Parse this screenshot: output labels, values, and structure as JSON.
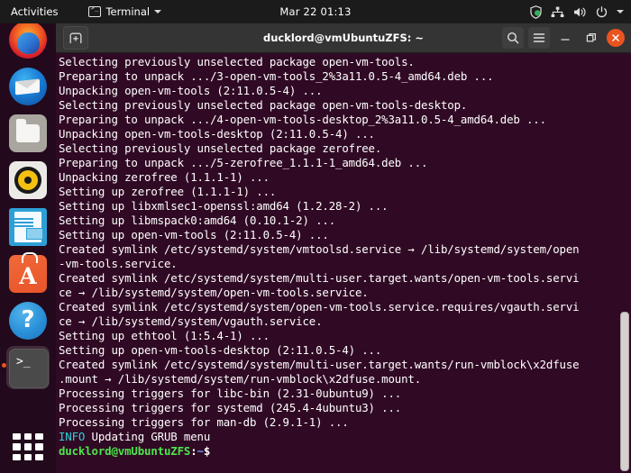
{
  "topbar": {
    "activities": "Activities",
    "app_menu": "Terminal",
    "clock": "Mar 22  01:13",
    "icons": [
      "shield-icon",
      "network-icon",
      "volume-icon",
      "power-icon",
      "chevron-down-icon"
    ]
  },
  "dock": {
    "items": [
      {
        "name": "firefox",
        "label": "Firefox",
        "running": false
      },
      {
        "name": "thunderbird",
        "label": "Thunderbird Mail",
        "running": false
      },
      {
        "name": "files",
        "label": "Files",
        "running": false
      },
      {
        "name": "rhythmbox",
        "label": "Rhythmbox",
        "running": false
      },
      {
        "name": "libreoffice-writer",
        "label": "LibreOffice Writer",
        "running": false
      },
      {
        "name": "ubuntu-software",
        "label": "Ubuntu Software",
        "running": false
      },
      {
        "name": "help",
        "label": "Help",
        "running": false
      },
      {
        "name": "terminal",
        "label": "Terminal",
        "running": true
      }
    ],
    "show_applications": "Show Applications"
  },
  "window": {
    "title": "ducklord@vmUbuntuZFS: ~",
    "new_tab_label": "+",
    "search_label": "Search",
    "menu_label": "Menu",
    "minimize_label": "Minimize",
    "maximize_label": "Restore",
    "close_label": "Close"
  },
  "terminal": {
    "background": "#300a24",
    "foreground": "#ffffff",
    "info_color": "#2fd0d6",
    "prompt_user_color": "#4ee44e",
    "prompt_path_color": "#6b9df5",
    "lines": [
      "Selecting previously unselected package open-vm-tools.",
      "Preparing to unpack .../3-open-vm-tools_2%3a11.0.5-4_amd64.deb ...",
      "Unpacking open-vm-tools (2:11.0.5-4) ...",
      "Selecting previously unselected package open-vm-tools-desktop.",
      "Preparing to unpack .../4-open-vm-tools-desktop_2%3a11.0.5-4_amd64.deb ...",
      "Unpacking open-vm-tools-desktop (2:11.0.5-4) ...",
      "Selecting previously unselected package zerofree.",
      "Preparing to unpack .../5-zerofree_1.1.1-1_amd64.deb ...",
      "Unpacking zerofree (1.1.1-1) ...",
      "Setting up zerofree (1.1.1-1) ...",
      "Setting up libxmlsec1-openssl:amd64 (1.2.28-2) ...",
      "Setting up libmspack0:amd64 (0.10.1-2) ...",
      "Setting up open-vm-tools (2:11.0.5-4) ...",
      "Created symlink /etc/systemd/system/vmtoolsd.service → /lib/systemd/system/open",
      "-vm-tools.service.",
      "Created symlink /etc/systemd/system/multi-user.target.wants/open-vm-tools.servi",
      "ce → /lib/systemd/system/open-vm-tools.service.",
      "Created symlink /etc/systemd/system/open-vm-tools.service.requires/vgauth.servi",
      "ce → /lib/systemd/system/vgauth.service.",
      "Setting up ethtool (1:5.4-1) ...",
      "Setting up open-vm-tools-desktop (2:11.0.5-4) ...",
      "Created symlink /etc/systemd/system/multi-user.target.wants/run-vmblock\\x2dfuse",
      ".mount → /lib/systemd/system/run-vmblock\\x2dfuse.mount.",
      "Processing triggers for libc-bin (2.31-0ubuntu9) ...",
      "Processing triggers for systemd (245.4-4ubuntu3) ...",
      "Processing triggers for man-db (2.9.1-1) ..."
    ],
    "info_line": {
      "tag": "INFO",
      "text": " Updating GRUB menu"
    },
    "prompt": {
      "user_host": "ducklord@vmUbuntuZFS",
      "colon": ":",
      "path": "~",
      "sigil": "$"
    }
  }
}
